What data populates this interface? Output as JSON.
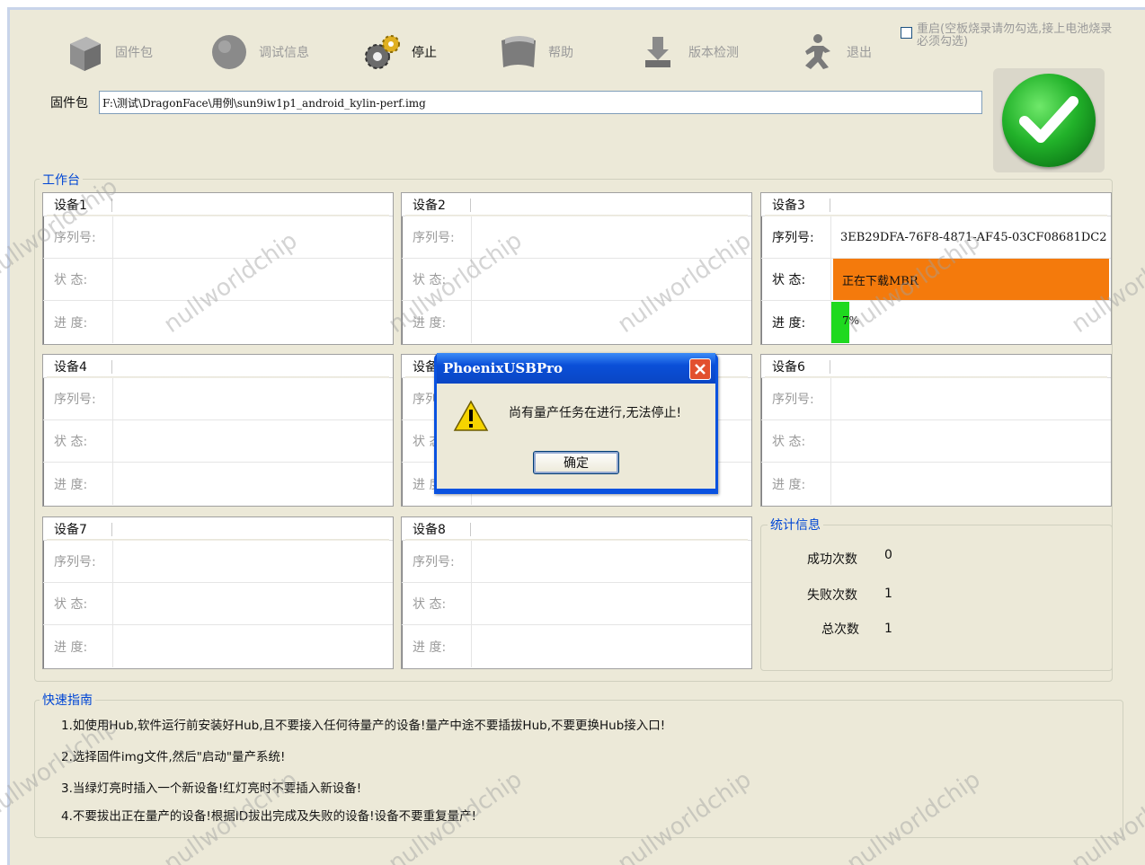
{
  "toolbar": {
    "items": [
      {
        "label": "固件包",
        "icon": "package-icon"
      },
      {
        "label": "调试信息",
        "icon": "debug-circle-icon"
      },
      {
        "label": "停止",
        "icon": "gears-icon"
      },
      {
        "label": "帮助",
        "icon": "book-icon"
      },
      {
        "label": "版本检测",
        "icon": "version-check-icon"
      },
      {
        "label": "退出",
        "icon": "exit-icon"
      }
    ],
    "reboot_label": "重启(空板烧录请勿勾选,接上电池烧录必须勾选)"
  },
  "firmware": {
    "label": "固件包",
    "path": "F:\\测试\\DragonFace\\用例\\sun9iw1p1_android_kylin-perf.img"
  },
  "workbench": {
    "title": "工作台"
  },
  "fields": {
    "serial": "序列号:",
    "status": "状  态:",
    "progress": "进  度:"
  },
  "devices": [
    {
      "name": "设备1",
      "serial": "",
      "status": "",
      "progress": ""
    },
    {
      "name": "设备2",
      "serial": "",
      "status": "",
      "progress": ""
    },
    {
      "name": "设备3",
      "serial": "3EB29DFA-76F8-4871-AF45-03CF08681DC2",
      "status": "正在下载MBR",
      "progress": "7%",
      "progress_value": 0.07
    },
    {
      "name": "设备4",
      "serial": "",
      "status": "",
      "progress": ""
    },
    {
      "name": "设备5",
      "serial": "",
      "status": "",
      "progress": ""
    },
    {
      "name": "设备6",
      "serial": "",
      "status": "",
      "progress": ""
    },
    {
      "name": "设备7",
      "serial": "",
      "status": "",
      "progress": ""
    },
    {
      "name": "设备8",
      "serial": "",
      "status": "",
      "progress": ""
    }
  ],
  "stats": {
    "title": "统计信息",
    "success_label": "成功次数",
    "success": "0",
    "fail_label": "失败次数",
    "fail": "1",
    "total_label": "总次数",
    "total": "1"
  },
  "guide": {
    "title": "快速指南",
    "lines": [
      "1.如使用Hub,软件运行前安装好Hub,且不要接入任何待量产的设备!量产中途不要插拔Hub,不要更换Hub接入口!",
      "2.选择固件img文件,然后\"启动\"量产系统!",
      "3.当绿灯亮时插入一个新设备!红灯亮时不要插入新设备!",
      "4.不要拔出正在量产的设备!根据ID拔出完成及失败的设备!设备不要重复量产!"
    ]
  },
  "dialog": {
    "title": "PhoenixUSBPro",
    "message": "尚有量产任务在进行,无法停止!",
    "ok_label": "确定"
  },
  "watermark": "nullworldchip",
  "colors": {
    "status_orange": "#f47a0c",
    "progress_green": "#1fd91f",
    "group_title": "#0046d5"
  }
}
